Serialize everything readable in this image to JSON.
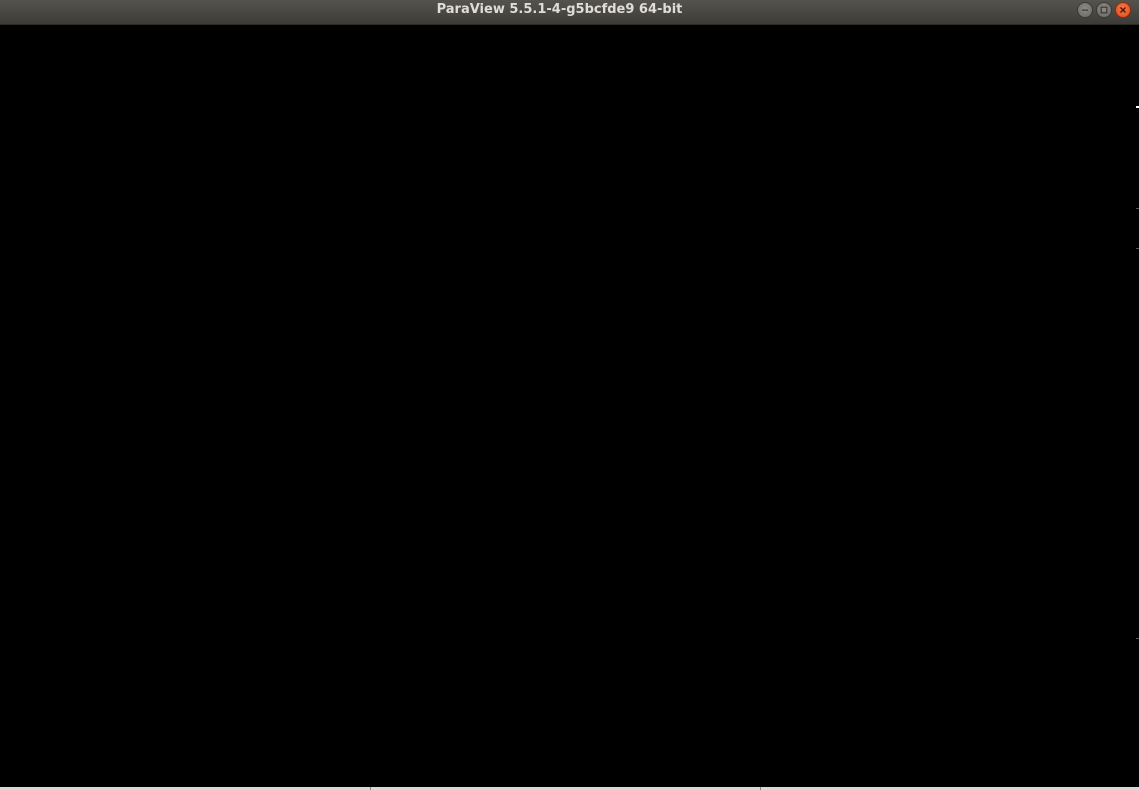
{
  "window": {
    "title": "ParaView 5.5.1-4-g5bcfde9 64-bit",
    "controls": [
      {
        "name": "minimize",
        "icon": "minimize-icon"
      },
      {
        "name": "maximize",
        "icon": "maximize-icon"
      },
      {
        "name": "close",
        "icon": "close-icon"
      }
    ]
  },
  "viewport": {
    "background": "#000000"
  },
  "colors": {
    "titlebar": "#3d3c38",
    "title_text": "#e0ddd5",
    "close_button": "#df4a16",
    "window_button": "#6a6862"
  }
}
